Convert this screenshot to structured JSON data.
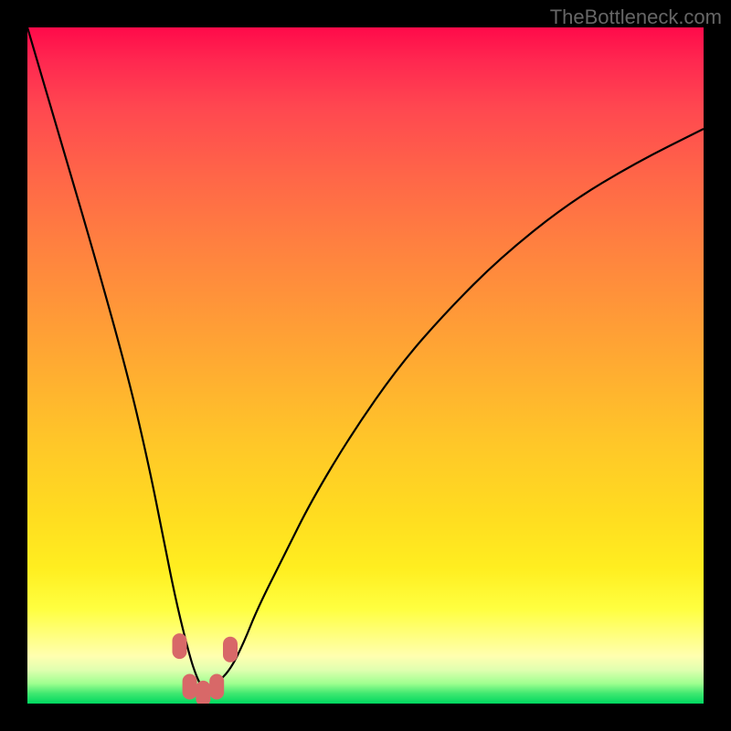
{
  "watermark": "TheBottleneck.com",
  "chart_data": {
    "type": "line",
    "title": "",
    "xlabel": "",
    "ylabel": "",
    "series": [
      {
        "name": "bottleneck-curve",
        "description": "V-shaped performance bottleneck curve with minimum at optimal configuration",
        "x": [
          0,
          5,
          10,
          15,
          18,
          20,
          22,
          24,
          25,
          26,
          27,
          28,
          30,
          32,
          34,
          38,
          42,
          48,
          55,
          62,
          70,
          80,
          90,
          100
        ],
        "y": [
          100,
          83,
          66,
          48,
          35,
          25,
          15,
          7,
          4,
          2,
          2,
          3,
          5,
          9,
          14,
          22,
          30,
          40,
          50,
          58,
          66,
          74,
          80,
          85
        ]
      }
    ],
    "markers": [
      {
        "x": 22.5,
        "y": 8.5,
        "label": "marker-1"
      },
      {
        "x": 24,
        "y": 2.5,
        "label": "marker-2"
      },
      {
        "x": 26,
        "y": 1.5,
        "label": "marker-3"
      },
      {
        "x": 28,
        "y": 2.5,
        "label": "marker-4"
      },
      {
        "x": 30,
        "y": 8,
        "label": "marker-5"
      }
    ],
    "xlim": [
      0,
      100
    ],
    "ylim": [
      0,
      100
    ],
    "background_gradient": {
      "type": "vertical",
      "stops": [
        {
          "pos": 0,
          "color": "#ff0a4a"
        },
        {
          "pos": 50,
          "color": "#ffb030"
        },
        {
          "pos": 85,
          "color": "#ffff40"
        },
        {
          "pos": 100,
          "color": "#00d860"
        }
      ]
    }
  }
}
